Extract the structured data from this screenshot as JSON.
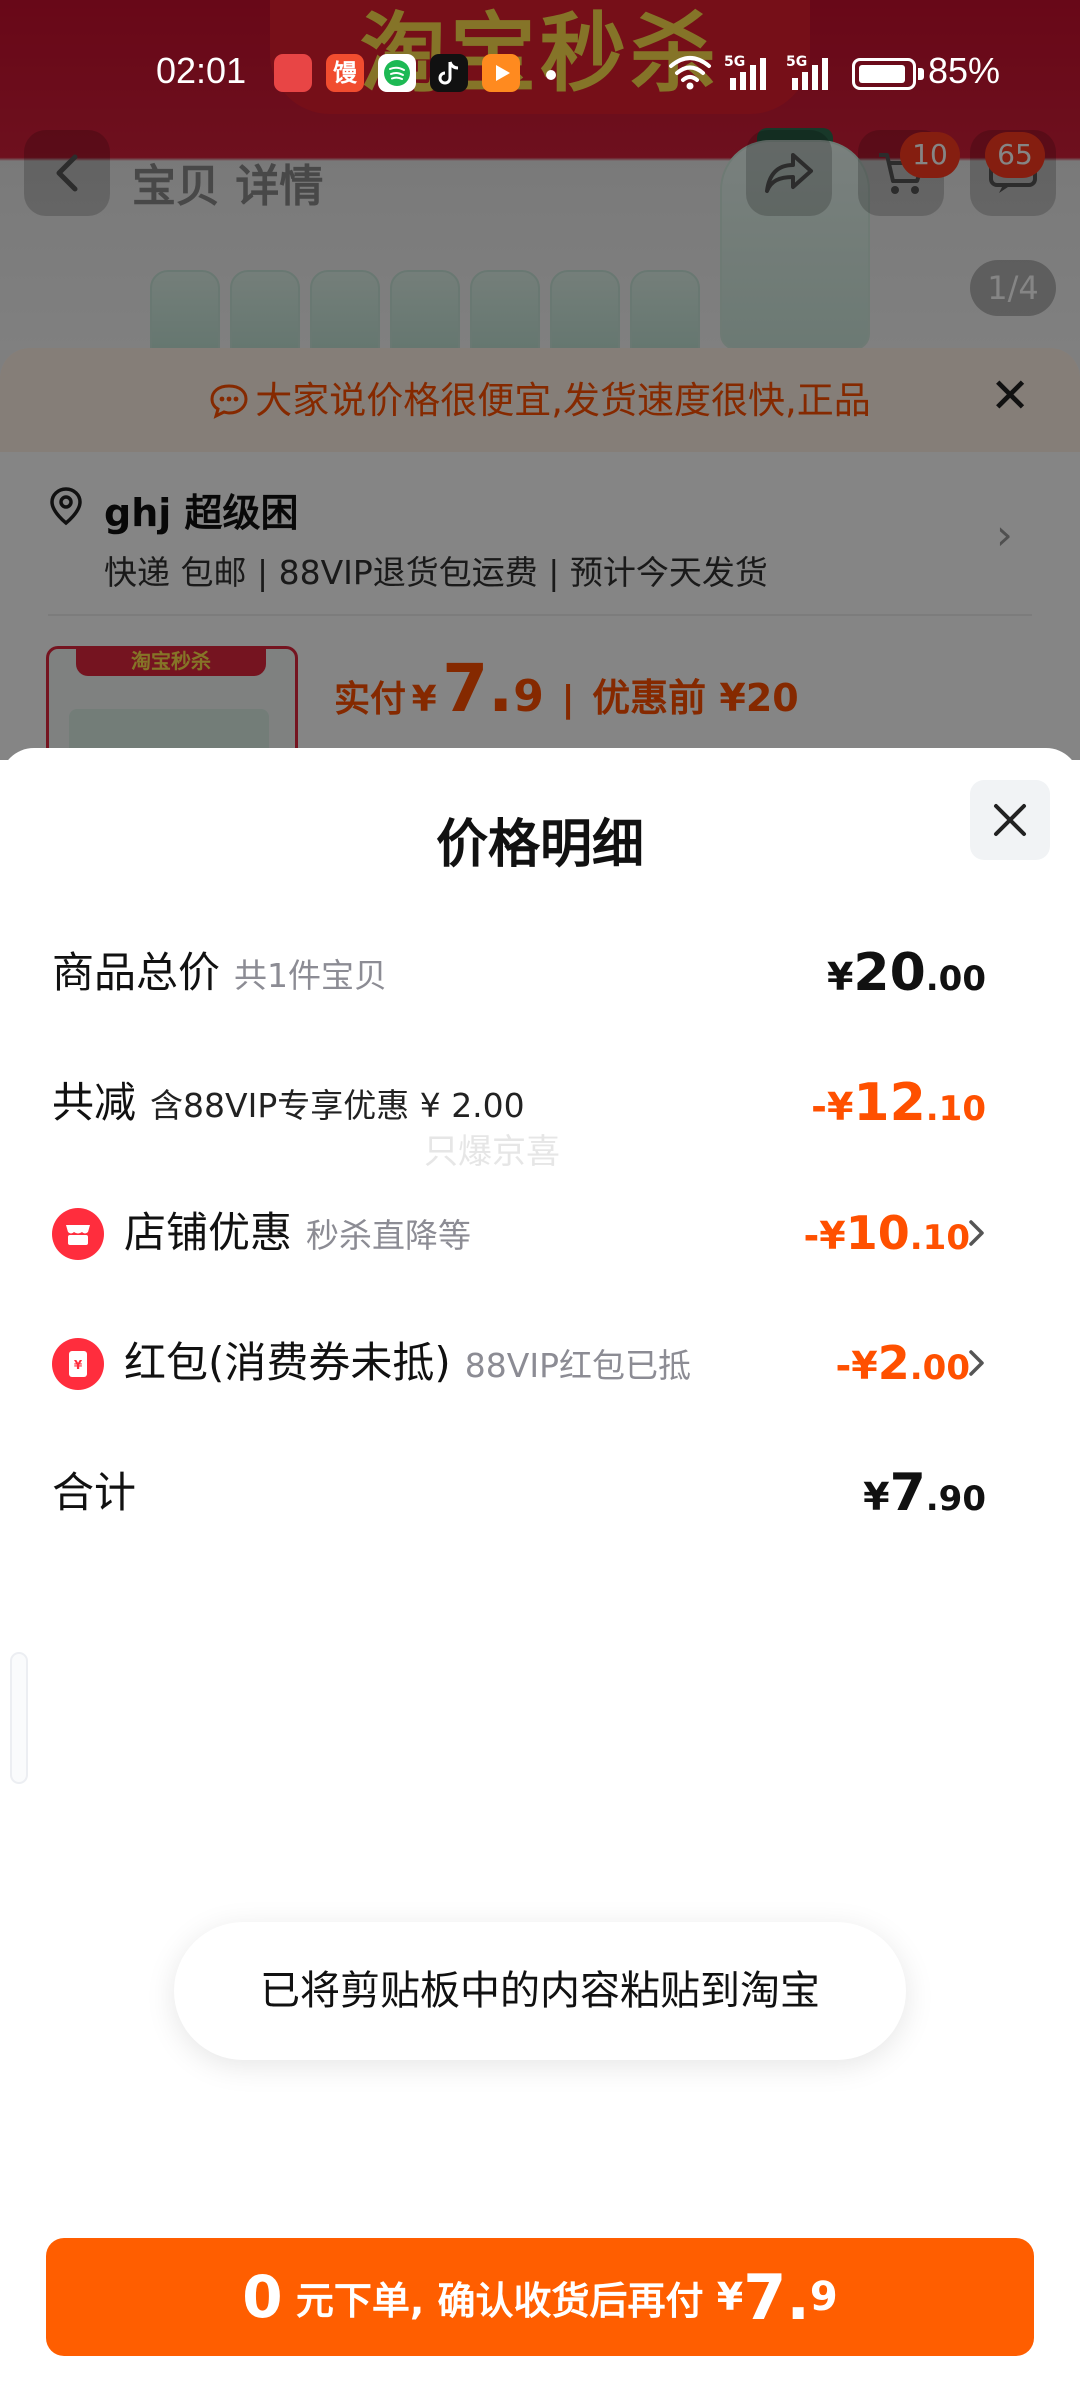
{
  "status_bar": {
    "time": "02:01",
    "app2_label": "馒",
    "battery": "85%"
  },
  "background": {
    "banner_text": "淘宝秒杀",
    "search_text": "宝贝 详情",
    "cart_badge": "10",
    "more_badge": "65",
    "image_counter": "1/4",
    "notice": "大家说价格很便宜,发货速度很快,正品",
    "address_name": "ghj 超级困",
    "address_sub": "快递 包邮 | 88VIP退货包运费 | 预计今天发货",
    "product_tag": "淘宝秒杀",
    "paid_label": "实付",
    "paid_currency": "¥",
    "paid_int": "7.",
    "paid_dec": "9",
    "before_label": "优惠前 ¥20"
  },
  "sheet": {
    "title": "价格明细",
    "rows": [
      {
        "label": "商品总价",
        "note": "共1件宝贝",
        "sign": "¥",
        "int": "20",
        "dec": ".00"
      },
      {
        "label": "共减",
        "note": "含88VIP专享优惠 ¥ 2.00",
        "sign": "-¥",
        "int": "12",
        "dec": ".10"
      },
      {
        "label": "店铺优惠",
        "note": "秒杀直降等",
        "sign": "-¥",
        "int": "10",
        "dec": ".10"
      },
      {
        "label": "红包(消费券未抵)",
        "note": "88VIP红包已抵",
        "sign": "-¥",
        "int": "2",
        "dec": ".00"
      },
      {
        "label": "合计",
        "note": "",
        "sign": "¥",
        "int": "7",
        "dec": ".90"
      }
    ],
    "watermark": "只爆京喜",
    "toast": "已将剪贴板中的内容粘贴到淘宝",
    "cta": {
      "zero": "0",
      "text": " 元下单, 确认收货后再付 ",
      "currency": "¥",
      "int": "7.",
      "dec": "9"
    }
  },
  "colors": {
    "accent_orange": "#ff5000",
    "cta_bg": "#ff5e00",
    "icon_red": "#ff2d3d"
  }
}
